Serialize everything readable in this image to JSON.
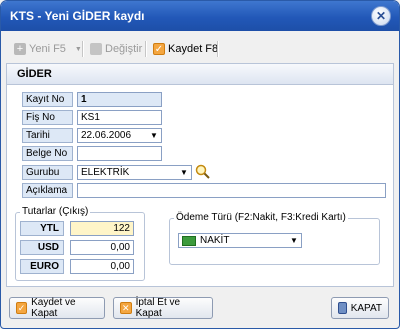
{
  "window": {
    "title": "KTS - Yeni GİDER kaydı"
  },
  "toolbar": {
    "new_label": "Yeni F5",
    "change_label": "Değiştir",
    "save_label": "Kaydet F8"
  },
  "panel": {
    "header": "GİDER"
  },
  "form": {
    "kayit_no": {
      "label": "Kayıt No",
      "value": "1"
    },
    "fis_no": {
      "label": "Fiş No",
      "value": "KS1"
    },
    "tarihi": {
      "label": "Tarihi",
      "value": "22.06.2006"
    },
    "belge_no": {
      "label": "Belge No",
      "value": ""
    },
    "gurubu": {
      "label": "Gurubu",
      "value": "ELEKTRİK"
    },
    "aciklama": {
      "label": "Açıklama",
      "value": ""
    }
  },
  "amounts": {
    "title": "Tutarlar (Çıkış)",
    "rows": [
      {
        "label": "YTL",
        "value": "122"
      },
      {
        "label": "USD",
        "value": "0,00"
      },
      {
        "label": "EURO",
        "value": "0,00"
      }
    ]
  },
  "payment": {
    "title": "Ödeme Türü (F2:Nakit, F3:Kredi Kartı)",
    "value": "NAKİT"
  },
  "buttons": {
    "save_close": "Kaydet ve Kapat",
    "cancel_close": "İptal Et ve Kapat",
    "close": "KAPAT"
  },
  "colors": {
    "titlebar": "#2258b8",
    "label_bg": "#dde8f6",
    "active_field": "#fff5c8"
  },
  "icons": [
    "close-icon",
    "add-icon",
    "edit-icon",
    "save-check-icon",
    "dropdown-arrow-icon",
    "search-icon",
    "money-icon",
    "cancel-icon",
    "exit-door-icon"
  ]
}
